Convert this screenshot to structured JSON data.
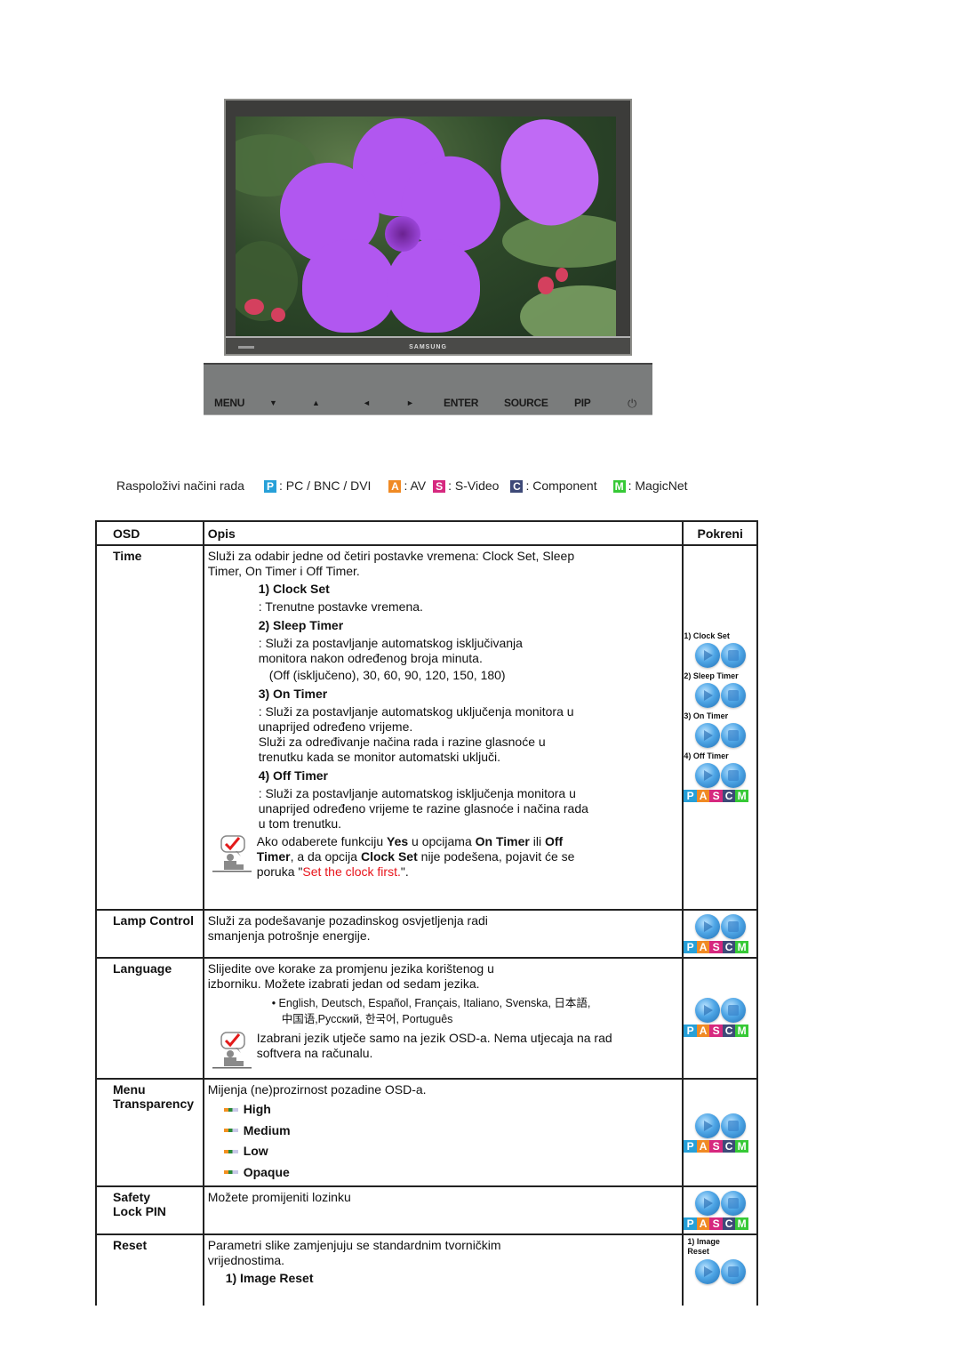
{
  "monitor": {
    "brand": "SAMSUNG",
    "control_panel": [
      {
        "id": "menu",
        "label": "MENU"
      },
      {
        "id": "down",
        "label": "▼"
      },
      {
        "id": "up",
        "label": "▲"
      },
      {
        "id": "left",
        "label": "◄"
      },
      {
        "id": "right",
        "label": "►"
      },
      {
        "id": "enter",
        "label": "ENTER"
      },
      {
        "id": "source",
        "label": "SOURCE"
      },
      {
        "id": "pip",
        "label": "PIP"
      },
      {
        "id": "power",
        "label": "⏻"
      }
    ]
  },
  "modes": {
    "label": "Raspoloživi načini rada",
    "items": [
      {
        "letter": "P",
        "text": ": PC / BNC / DVI",
        "color": "#27a0d8"
      },
      {
        "letter": "A",
        "text": ": AV",
        "color": "#f08a24"
      },
      {
        "letter": "S",
        "text": ": S-Video",
        "color": "#d6287f"
      },
      {
        "letter": "C",
        "text": ": Component",
        "color": "#3e4a78"
      },
      {
        "letter": "M",
        "text": ": MagicNet",
        "color": "#36c936"
      }
    ]
  },
  "table": {
    "headers": {
      "osd": "OSD",
      "desc": "Opis",
      "run": "Pokreni"
    },
    "rows": {
      "time": {
        "name": "Time",
        "intro": "Služi za odabir jedne od četiri postavke vremena: Clock Set, Sleep Timer, On Timer i Off Timer.",
        "clock_set": {
          "title": "1) Clock Set",
          "text": ": Trenutne postavke vremena."
        },
        "sleep_timer": {
          "title": "2) Sleep Timer",
          "text": ": Služi za postavljanje automatskog isključivanja monitora nakon određenog broja minuta.",
          "options": "(Off (isključeno), 30, 60, 90, 120, 150, 180)"
        },
        "on_timer": {
          "title": "3) On Timer",
          "text1": ": Služi za postavljanje automatskog uključenja monitora u unaprijed određeno vrijeme.",
          "text2": "Služi za određivanje načina rada i razine glasnoće u trenutku kada se monitor automatski uključi."
        },
        "off_timer": {
          "title": "4) Off Timer",
          "text": ": Služi za postavljanje automatskog isključenja monitora u unaprijed određeno vrijeme te razine glasnoće i načina rada u tom trenutku."
        },
        "note": {
          "p1": "Ako odaberete funkciju ",
          "b1": "Yes",
          "p2": " u opcijama ",
          "b2": "On Timer",
          "p3": " ili ",
          "b3": "Off Timer",
          "p4": ", a da opcija ",
          "b4": "Clock Set",
          "p5": " nije podešena, pojavit će se poruka \"",
          "msg": "Set the clock first.",
          "p6": "\"."
        },
        "run_labels": [
          "1) Clock Set",
          "2) Sleep Timer",
          "3) On Timer",
          "4) Off Timer"
        ]
      },
      "lamp": {
        "name": "Lamp Control",
        "text": "Služi za podešavanje pozadinskog osvjetljenja radi smanjenja potrošnje energije."
      },
      "language": {
        "name": "Language",
        "text": "Slijedite ove korake za promjenu jezika korištenog u izborniku. Možete izabrati jedan od sedam jezika.",
        "list_line1": "• English, Deutsch, Español, Français, Italiano, Svenska, 日本語,",
        "list_line2": "中国语,Русский, 한국어,  Português",
        "note": "Izabrani jezik utječe samo na jezik OSD-a. Nema utjecaja na rad softvera na računalu."
      },
      "transparency": {
        "name_line1": "Menu",
        "name_line2": "Transparency",
        "text": "Mijenja (ne)prozirnost pozadine OSD-a.",
        "options": [
          "High",
          "Medium",
          "Low",
          "Opaque"
        ]
      },
      "safety": {
        "name_line1": "Safety",
        "name_line2": "Lock PIN",
        "text": "Možete promijeniti lozinku"
      },
      "reset": {
        "name": "Reset",
        "text": "Parametri slike zamjenjuju se standardnim tvorničkim vrijednostima.",
        "sub": "1) Image Reset",
        "run_label_line1": "1) Image",
        "run_label_line2": "Reset"
      }
    },
    "pascm": [
      {
        "letter": "P",
        "color": "#27a0d8"
      },
      {
        "letter": "A",
        "color": "#f08a24"
      },
      {
        "letter": "S",
        "color": "#d6287f"
      },
      {
        "letter": "C",
        "color": "#3e4a78"
      },
      {
        "letter": "M",
        "color": "#36c936"
      }
    ]
  }
}
